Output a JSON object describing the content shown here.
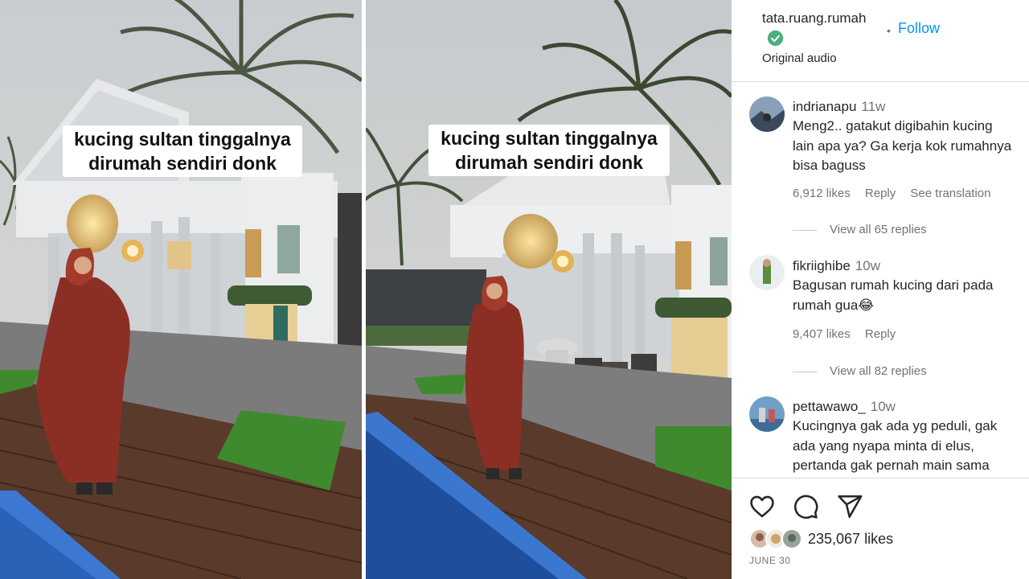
{
  "video": {
    "left_caption": "kucing sultan tinggalnya dirumah sendiri donk",
    "right_caption": "kucing sultan tinggalnya dirumah sendiri donk"
  },
  "post": {
    "username": "tata.ruang.rumah",
    "separator": "•",
    "follow_label": "Follow",
    "audio_label": "Original audio"
  },
  "comments": [
    {
      "username": "indrianapu",
      "time": "11w",
      "text_lines": [
        "Meng2.. gatakut digibahin kucing",
        "lain apa ya? Ga kerja kok rumahnya",
        "bisa baguss"
      ],
      "likes": "6,912 likes",
      "reply_label": "Reply",
      "translate_label": "See translation",
      "view_replies": "View all 65 replies"
    },
    {
      "username": "fikriighibe",
      "time": "10w",
      "text_lines": [
        "Bagusan rumah kucing dari pada",
        "rumah gua😂"
      ],
      "likes": "9,407 likes",
      "reply_label": "Reply",
      "view_replies": "View all 82 replies"
    },
    {
      "username": "pettawawo_",
      "time": "10w",
      "text_lines": [
        "Kucingnya gak ada yg peduli, gak",
        "ada yang nyapa minta di elus,",
        "pertanda gak pernah main sama"
      ]
    }
  ],
  "footer": {
    "likes_count": "235,067 likes",
    "date": "JUNE 30"
  },
  "icons": {
    "like": "heart-icon",
    "comment": "comment-icon",
    "share": "share-icon",
    "verified": "verified-badge-icon"
  },
  "colors": {
    "follow": "#0095f6",
    "verified": "#4caf7d",
    "muted": "#737373"
  }
}
